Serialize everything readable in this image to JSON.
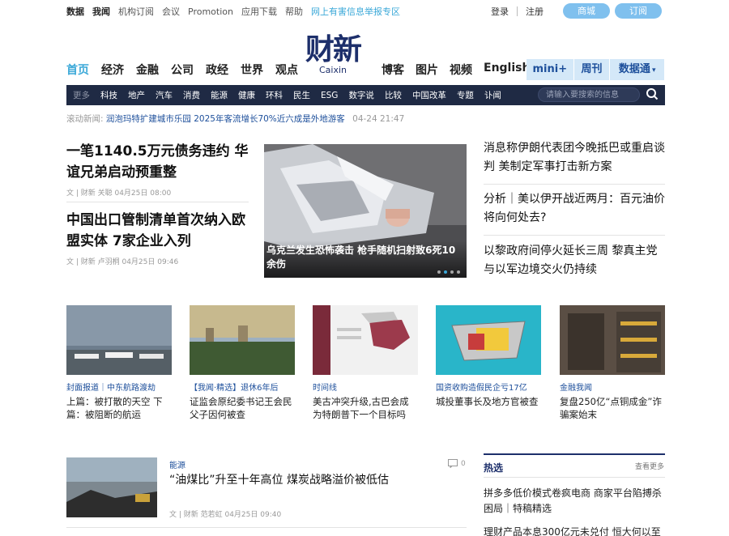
{
  "topbar": {
    "links": [
      "数据",
      "我闻",
      "机构订阅",
      "会议",
      "Promotion",
      "应用下载",
      "帮助"
    ],
    "report_link": "网上有害信息举报专区",
    "login": "登录",
    "register": "注册",
    "shop_button": "商城",
    "subscribe_button": "订阅"
  },
  "logo": {
    "cn": "财新",
    "en": "Caixin"
  },
  "main_nav": [
    "首页",
    "经济",
    "金融",
    "公司",
    "政经",
    "世界",
    "观点"
  ],
  "right_nav": [
    "博客",
    "图片",
    "视频",
    "English"
  ],
  "blue_tabs": [
    "mini+",
    "周刊",
    "数据通"
  ],
  "sub_nav": {
    "more": "更多",
    "items": [
      "科技",
      "地产",
      "汽车",
      "消费",
      "能源",
      "健康",
      "环科",
      "民生",
      "ESG",
      "数字说",
      "比较",
      "中国改革",
      "专题",
      "讣闻"
    ],
    "search_placeholder": "请输入要搜索的信息"
  },
  "ticker": {
    "label": "滚动新闻:",
    "text": "润泡玛特扩建城市乐园 2025年客流增长70%近六成是外地游客",
    "time": "04-24 21:47"
  },
  "leads": [
    {
      "title": "一笔1140.5万元债务违约 华谊兄弟启动预重整",
      "meta": "文 | 财新 关聪 04月25日 08:00"
    },
    {
      "title": "中国出口管制清单首次纳入欧盟实体 7家企业入列",
      "meta": "文 | 财新 卢羽桐 04月25日 09:46"
    }
  ],
  "hero": {
    "caption": "乌克兰发生恐怖袭击 枪手随机扫射致6死10余伤"
  },
  "right_headlines": [
    "消息称伊朗代表团今晚抵巴或重启谈判 美制定军事打击新方案",
    "分析｜美以伊开战近两月：百元油价将向何处去?",
    "以黎政府间停火延长三周 黎真主党与以军边境交火仍持续"
  ],
  "thumbs": [
    {
      "tag": "封面报道｜中东航路渡劫",
      "title": "上篇：被打散的天空 下篇：被阻断的航运"
    },
    {
      "tag": "【我闻·精选】退休6年后",
      "title": "证监会原纪委书记王会民父子因何被查"
    },
    {
      "tag": "时间线",
      "title": "美古冲突升级,古巴会成为特朗普下一个目标吗"
    },
    {
      "tag": "国资收购造假民企亏17亿",
      "title": "城投董事长及地方官被查"
    },
    {
      "tag": "金融我闻",
      "title": "复盘250亿“点铜成金”诈骗案始末"
    }
  ],
  "article": {
    "tag": "能源",
    "title": "“油煤比”升至十年高位 煤炭战略溢价被低估",
    "meta": "文 | 财新 范若虹 04月25日 09:40",
    "comments": "0"
  },
  "hot": {
    "title": "热选",
    "more": "查看更多",
    "items": [
      "拼多多低价模式卷疯电商 商家平台陷搏杀困局｜特稿精选",
      "理财产品本息300亿元未兑付 恒大何以至"
    ]
  }
}
